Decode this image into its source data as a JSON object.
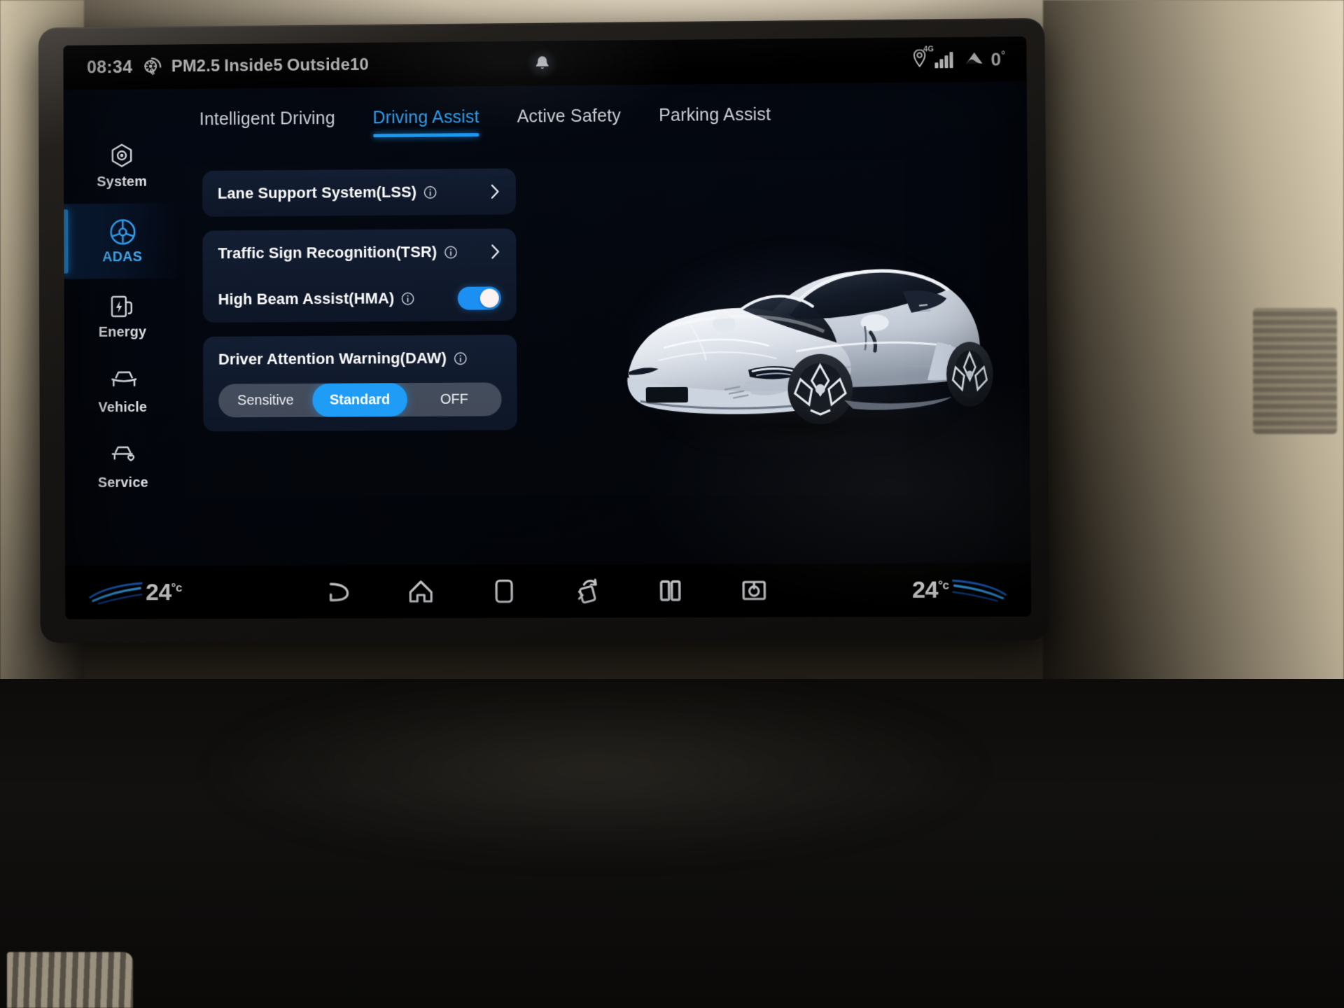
{
  "status_bar": {
    "time": "08:34",
    "pm_icon": "air-quality-icon",
    "pm_label": "PM2.5",
    "inside_label": "Inside",
    "inside_value": "5",
    "outside_label": "Outside",
    "outside_value": "10",
    "notification_icon": "bell-icon",
    "location_icon": "location-pin-icon",
    "network_label": "4G",
    "signal_icon": "signal-bars-icon",
    "outside_temp_icon": "outside-temp-icon",
    "outside_temp": "0",
    "outside_temp_unit": "°"
  },
  "sidebar": {
    "items": [
      {
        "label": "System",
        "icon": "system-hex-icon",
        "active": false
      },
      {
        "label": "ADAS",
        "icon": "steering-wheel-icon",
        "active": true
      },
      {
        "label": "Energy",
        "icon": "charging-station-icon",
        "active": false
      },
      {
        "label": "Vehicle",
        "icon": "car-front-icon",
        "active": false
      },
      {
        "label": "Service",
        "icon": "car-heart-icon",
        "active": false
      }
    ]
  },
  "tabs": [
    {
      "label": "Intelligent Driving",
      "active": false
    },
    {
      "label": "Driving Assist",
      "active": true
    },
    {
      "label": "Active Safety",
      "active": false
    },
    {
      "label": "Parking Assist",
      "active": false
    }
  ],
  "settings": {
    "lane_support": {
      "label": "Lane Support System(LSS)",
      "info_icon": "info-icon",
      "chevron_icon": "chevron-right-icon"
    },
    "traffic_sign": {
      "label": "Traffic Sign Recognition(TSR)",
      "info_icon": "info-icon",
      "chevron_icon": "chevron-right-icon"
    },
    "high_beam": {
      "label": "High Beam Assist(HMA)",
      "info_icon": "info-icon",
      "toggle_state": "on"
    },
    "driver_attention": {
      "label": "Driver Attention Warning(DAW)",
      "info_icon": "info-icon",
      "options": [
        "Sensitive",
        "Standard",
        "OFF"
      ],
      "selected": "Standard"
    }
  },
  "vehicle_image": {
    "name": "vehicle-render",
    "description": "white electric sedan three-quarter front view"
  },
  "bottom_bar": {
    "temp_left": "24",
    "temp_left_unit": "°c",
    "temp_right": "24",
    "temp_right_unit": "°c",
    "nav": [
      {
        "name": "back-icon"
      },
      {
        "name": "home-icon"
      },
      {
        "name": "recents-icon"
      },
      {
        "name": "screen-rotate-icon"
      },
      {
        "name": "split-screen-icon"
      },
      {
        "name": "power-icon"
      }
    ]
  },
  "colors": {
    "accent_blue": "#1f9cf6",
    "tab_active": "#2fa5f8",
    "toggle_on": "#1b90f2",
    "card_bg": "#141f34",
    "screen_bg": "#04070f",
    "text_primary": "#fbfbfc"
  }
}
